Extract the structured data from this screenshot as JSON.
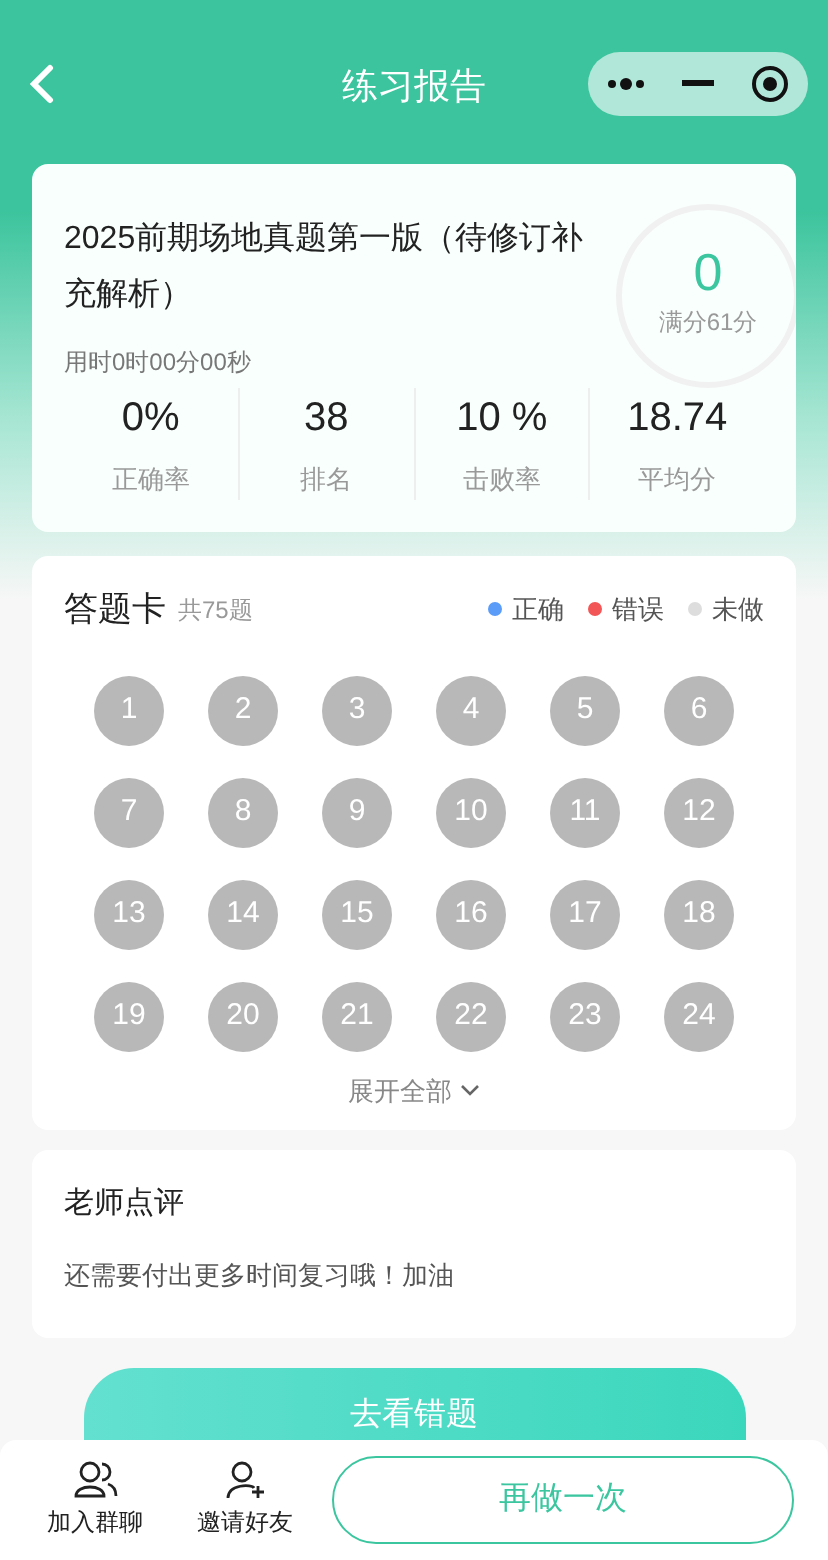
{
  "nav": {
    "title": "练习报告"
  },
  "summary": {
    "title": "2025前期场地真题第一版（待修订补充解析）",
    "time": "用时0时00分00秒",
    "score": "0",
    "full_score": "满分61分",
    "stats": [
      {
        "value": "0%",
        "label": "正确率"
      },
      {
        "value": "38",
        "label": "排名"
      },
      {
        "value": "10 %",
        "label": "击败率"
      },
      {
        "value": "18.74",
        "label": "平均分"
      }
    ]
  },
  "answer_card": {
    "title": "答题卡",
    "count": "共75题",
    "legend": [
      {
        "label": "正确",
        "color": "#5b9cf8"
      },
      {
        "label": "错误",
        "color": "#f35656"
      },
      {
        "label": "未做",
        "color": "#dddddd"
      }
    ],
    "items": [
      {
        "number": "1",
        "kind": "undone"
      },
      {
        "number": "2",
        "kind": "undone"
      },
      {
        "number": "3",
        "kind": "undone"
      },
      {
        "number": "4",
        "kind": "undone"
      },
      {
        "number": "5",
        "kind": "undone"
      },
      {
        "number": "6",
        "kind": "undone"
      },
      {
        "number": "7",
        "kind": "undone"
      },
      {
        "number": "8",
        "kind": "undone"
      },
      {
        "number": "9",
        "kind": "undone"
      },
      {
        "number": "10",
        "kind": "undone"
      },
      {
        "number": "11",
        "kind": "undone"
      },
      {
        "number": "12",
        "kind": "undone"
      },
      {
        "number": "13",
        "kind": "undone"
      },
      {
        "number": "14",
        "kind": "undone"
      },
      {
        "number": "15",
        "kind": "undone"
      },
      {
        "number": "16",
        "kind": "undone"
      },
      {
        "number": "17",
        "kind": "undone"
      },
      {
        "number": "18",
        "kind": "undone"
      },
      {
        "number": "19",
        "kind": "undone"
      },
      {
        "number": "20",
        "kind": "undone"
      },
      {
        "number": "21",
        "kind": "undone"
      },
      {
        "number": "22",
        "kind": "undone"
      },
      {
        "number": "23",
        "kind": "undone"
      },
      {
        "number": "24",
        "kind": "undone"
      }
    ],
    "expand": "展开全部"
  },
  "teacher_review": {
    "title": "老师点评",
    "comment": "还需要付出更多时间复习哦！加油"
  },
  "review_button": "去看错题",
  "bottom_bar": {
    "actions": [
      {
        "label": "加入群聊",
        "kind": "group"
      },
      {
        "label": "邀请好友",
        "kind": "invite"
      }
    ],
    "redo_button": "再做一次"
  }
}
